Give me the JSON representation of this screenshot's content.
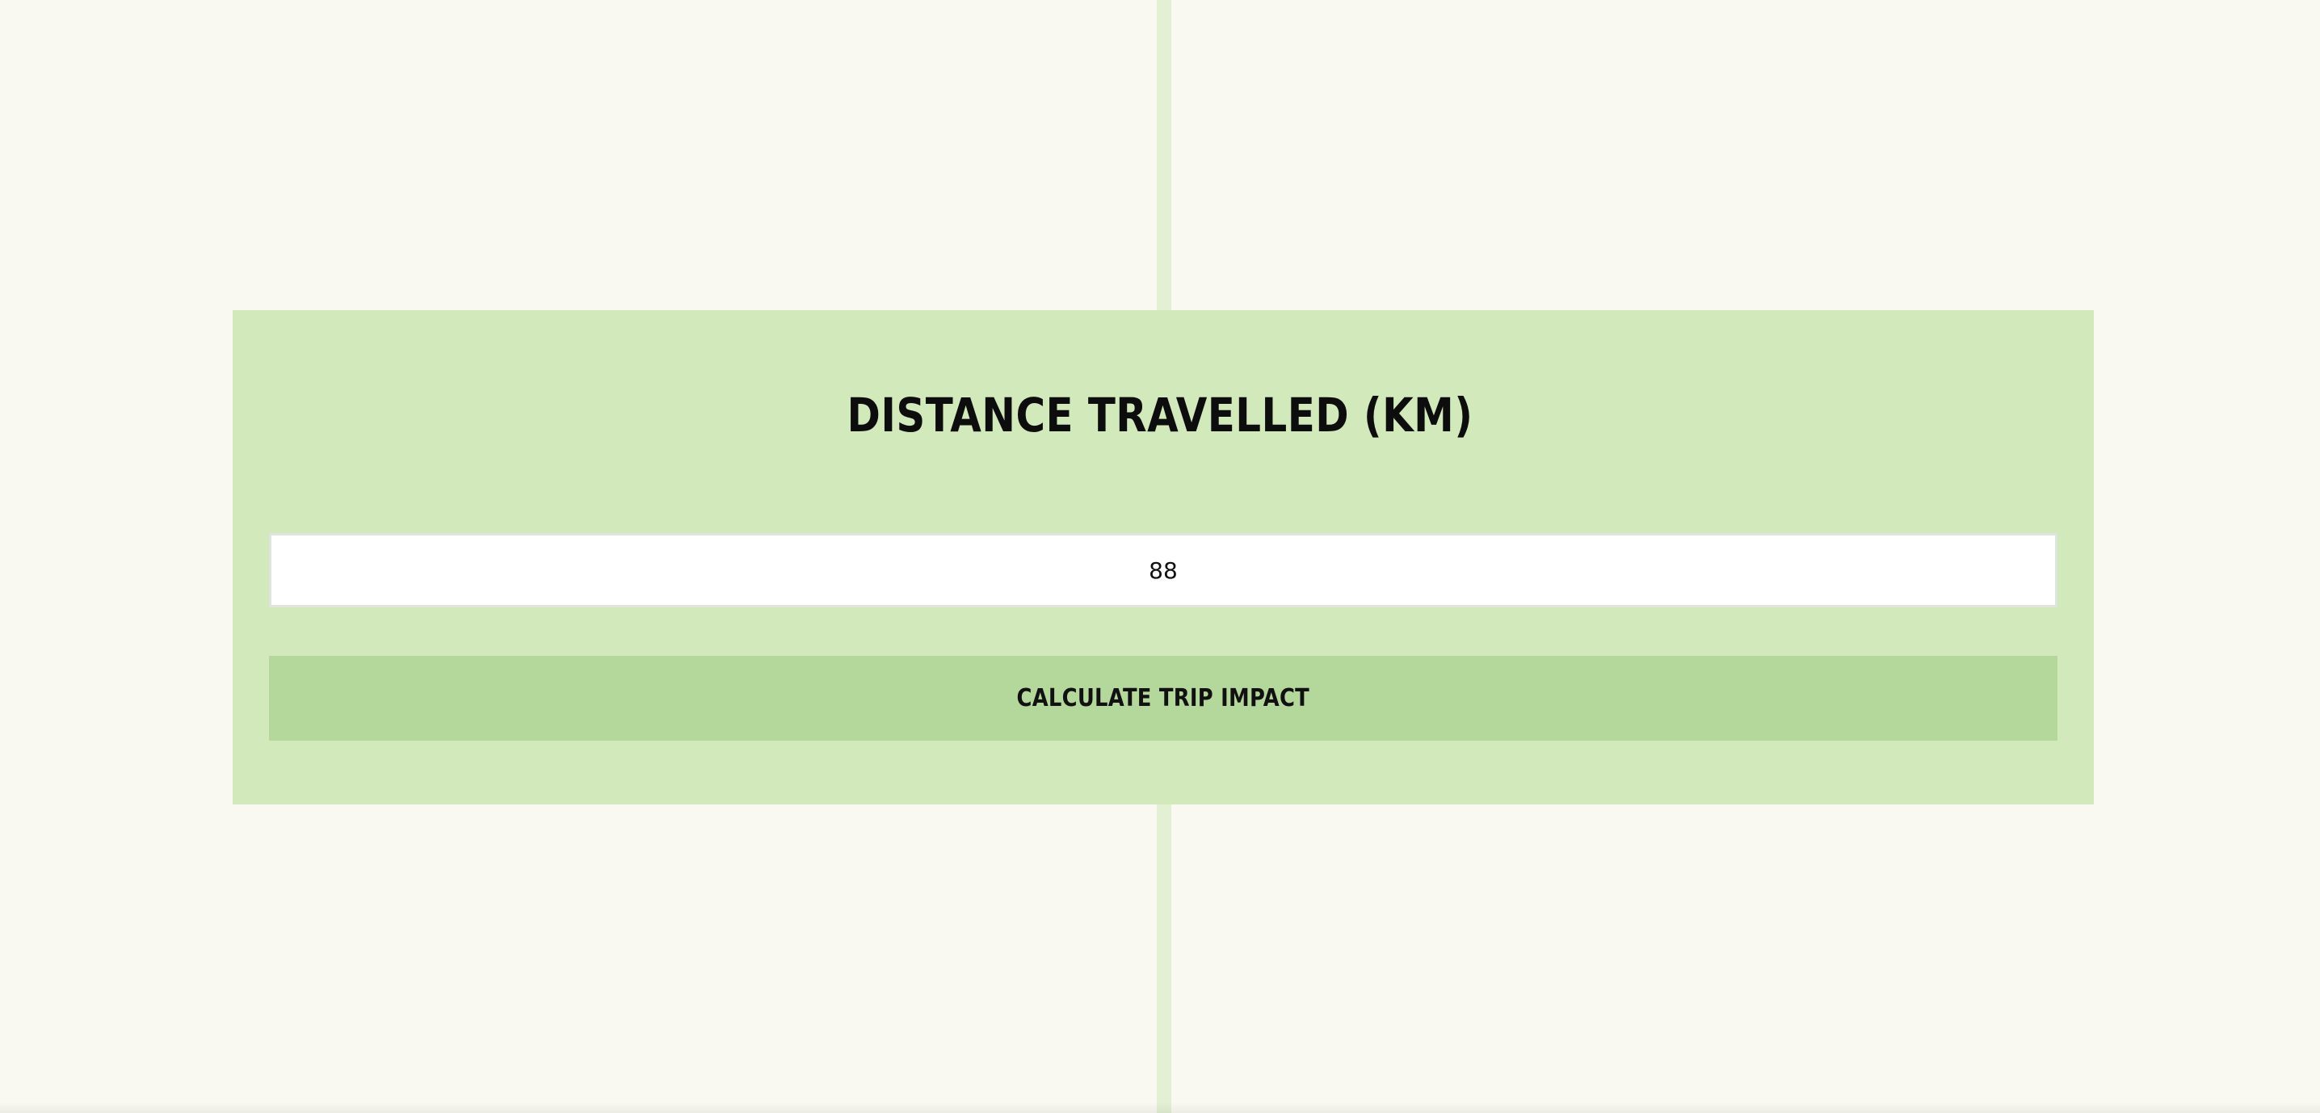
{
  "page": {
    "background_color": "#f9f9f1",
    "stripe_color": "#e3f0d4"
  },
  "card": {
    "background_color": "#d1e9bb",
    "title": "DISTANCE TRAVELLED (KM)",
    "distance_input": {
      "value": "88",
      "placeholder": ""
    },
    "calculate_button": {
      "label": "CALCULATE TRIP IMPACT",
      "background_color": "#b4d89b"
    }
  }
}
